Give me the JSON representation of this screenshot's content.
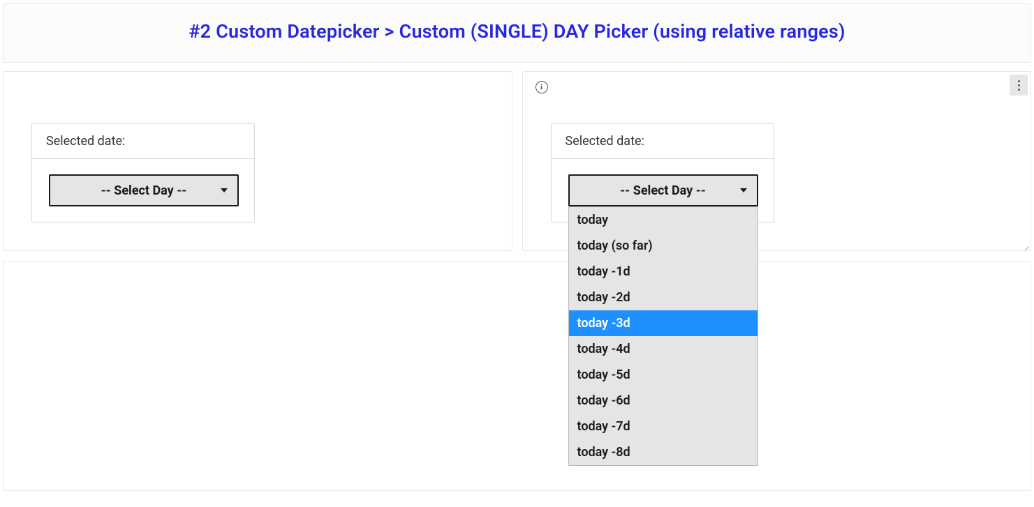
{
  "header": {
    "title": "#2 Custom Datepicker > Custom (SINGLE) DAY Picker (using relative ranges)"
  },
  "left_panel": {
    "label": "Selected date:",
    "select_placeholder": "-- Select Day --"
  },
  "right_panel": {
    "label": "Selected date:",
    "select_placeholder": "-- Select Day --",
    "dropdown_open": true,
    "highlighted_index": 4,
    "options": [
      "today",
      "today (so far)",
      "today -1d",
      "today -2d",
      "today -3d",
      "today -4d",
      "today -5d",
      "today -6d",
      "today -7d",
      "today -8d"
    ]
  },
  "colors": {
    "title": "#2727e0",
    "highlight": "#1e90ff",
    "border": "#e8e8e8",
    "select_bg": "#e5e5e5"
  }
}
